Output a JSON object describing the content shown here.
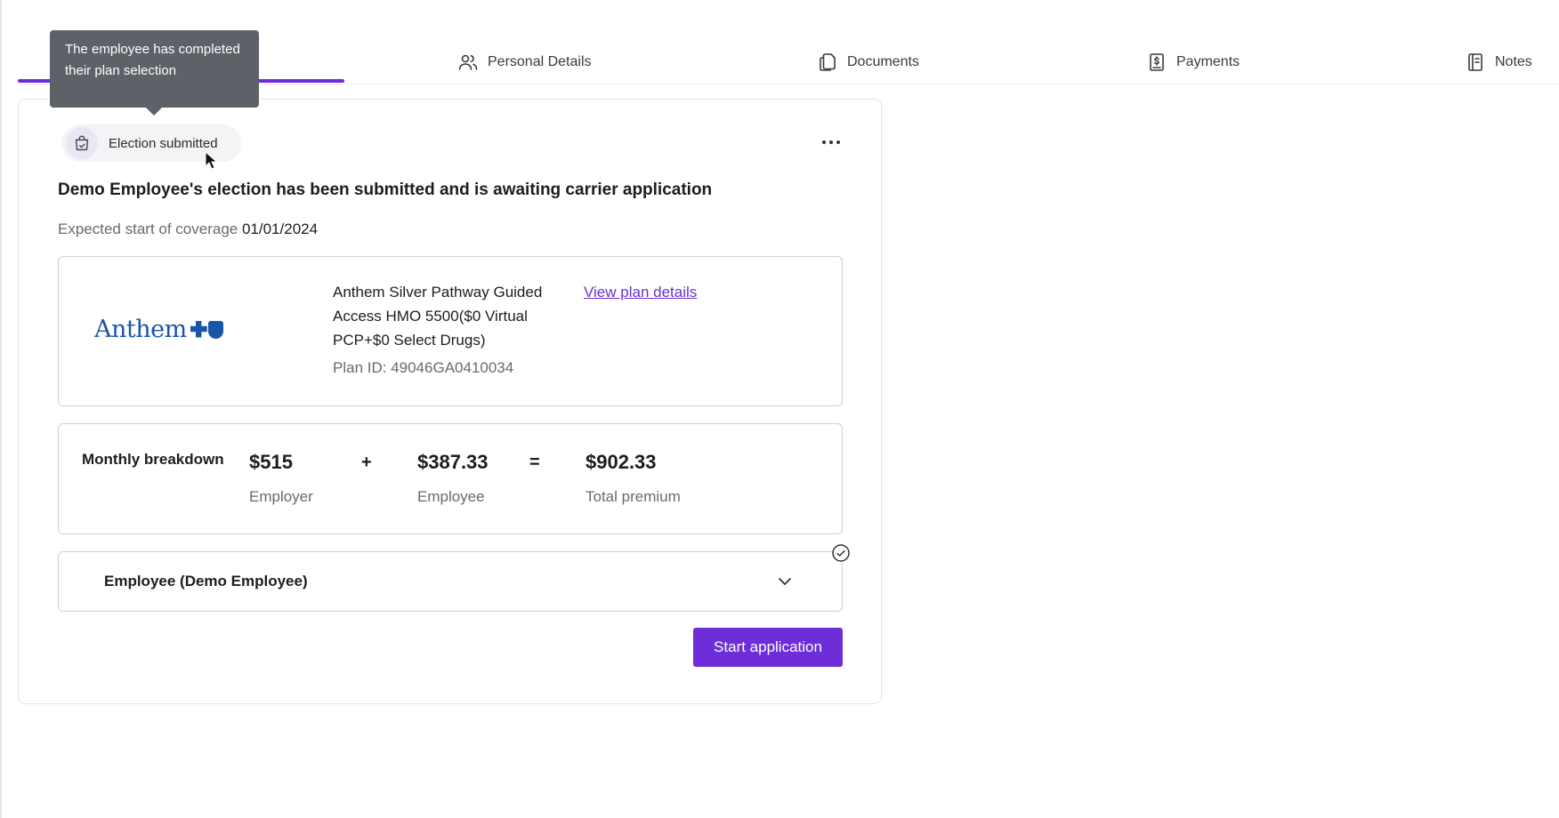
{
  "tabs": {
    "personal": {
      "label": "Personal Details",
      "icon": "users-icon"
    },
    "documents": {
      "label": "Documents",
      "icon": "documents-icon"
    },
    "payments": {
      "label": "Payments",
      "icon": "payment-receipt-icon"
    },
    "notes": {
      "label": "Notes",
      "icon": "notebook-icon"
    }
  },
  "tooltip": {
    "text": "The employee has completed their plan selection"
  },
  "status": {
    "label": "Election submitted",
    "icon": "bag-check-icon"
  },
  "headline": "Demo Employee's election has been submitted and is awaiting carrier application",
  "coverage": {
    "label": "Expected start of coverage",
    "date": "01/01/2024"
  },
  "plan": {
    "carrier_logo_text": "Anthem",
    "name": "Anthem Silver Pathway Guided Access HMO 5500($0 Virtual PCP+$0 Select Drugs)",
    "plan_id": "Plan ID: 49046GA0410034",
    "details_link": "View plan details"
  },
  "breakdown": {
    "label": "Monthly breakdown",
    "employer": {
      "amount": "$515",
      "label": "Employer"
    },
    "plus": "+",
    "employee": {
      "amount": "$387.33",
      "label": "Employee"
    },
    "equals": "=",
    "total": {
      "amount": "$902.33",
      "label": "Total premium"
    }
  },
  "accordion": {
    "label": "Employee (Demo Employee)"
  },
  "actions": {
    "start_application": "Start application"
  },
  "colors": {
    "accent": "#6d2ed8",
    "tooltip_bg": "#5f6168",
    "logo_blue": "#1a56a8"
  }
}
